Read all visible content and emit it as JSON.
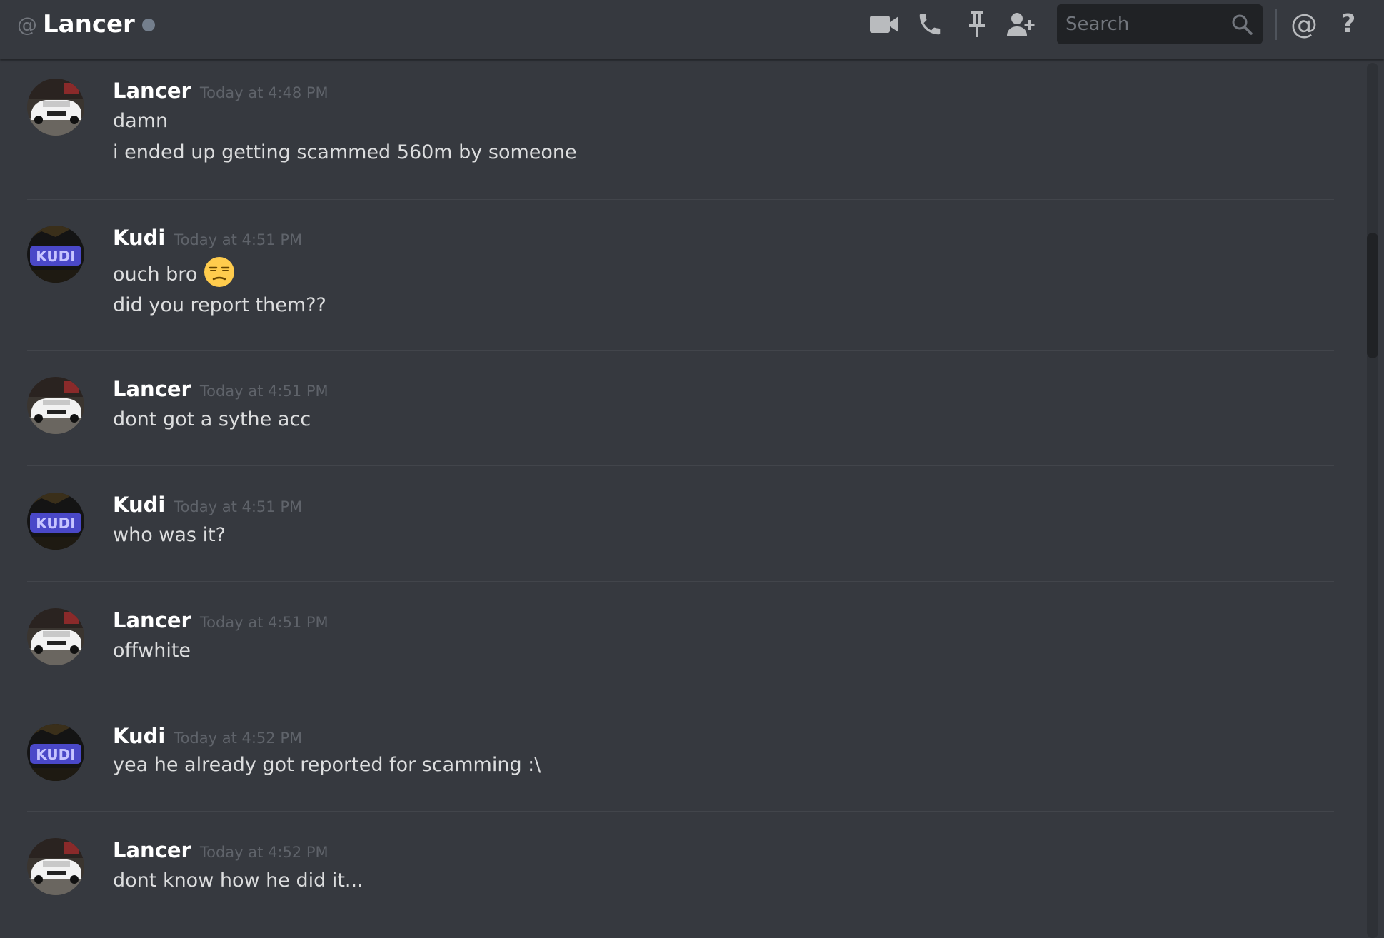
{
  "header": {
    "channel_prefix": "@",
    "channel_name": "Lancer",
    "status": "offline",
    "status_color": "#747f8d",
    "search_placeholder": "Search",
    "icons": [
      "video-call-icon",
      "voice-call-icon",
      "pin-icon",
      "add-friend-icon",
      "search-icon",
      "mention-icon",
      "help-icon"
    ]
  },
  "messages": [
    {
      "author": "Lancer",
      "timestamp": "Today at 4:48 PM",
      "avatar": "car-avatar",
      "lines": [
        "damn",
        "i ended up getting scammed 560m by someone"
      ]
    },
    {
      "author": "Kudi",
      "timestamp": "Today at 4:51 PM",
      "avatar": "graffiti-avatar",
      "lines": [
        "ouch bro",
        "did you report them??"
      ],
      "emoji": "unamused-face"
    },
    {
      "author": "Lancer",
      "timestamp": "Today at 4:51 PM",
      "avatar": "car-avatar",
      "lines": [
        "dont got a sythe acc"
      ]
    },
    {
      "author": "Kudi",
      "timestamp": "Today at 4:51 PM",
      "avatar": "graffiti-avatar",
      "lines": [
        "who was it?"
      ]
    },
    {
      "author": "Lancer",
      "timestamp": "Today at 4:51 PM",
      "avatar": "car-avatar",
      "lines": [
        "offwhite"
      ]
    },
    {
      "author": "Kudi",
      "timestamp": "Today at 4:52 PM",
      "avatar": "graffiti-avatar",
      "lines": [
        "yea he already got reported for scamming :\\"
      ]
    },
    {
      "author": "Lancer",
      "timestamp": "Today at 4:52 PM",
      "avatar": "car-avatar",
      "lines": [
        "dont know how he did it..."
      ]
    }
  ],
  "colors": {
    "background": "#36393f",
    "username": "#ffffff",
    "message_text": "#dcddde",
    "timestamp": "#5f636a"
  }
}
